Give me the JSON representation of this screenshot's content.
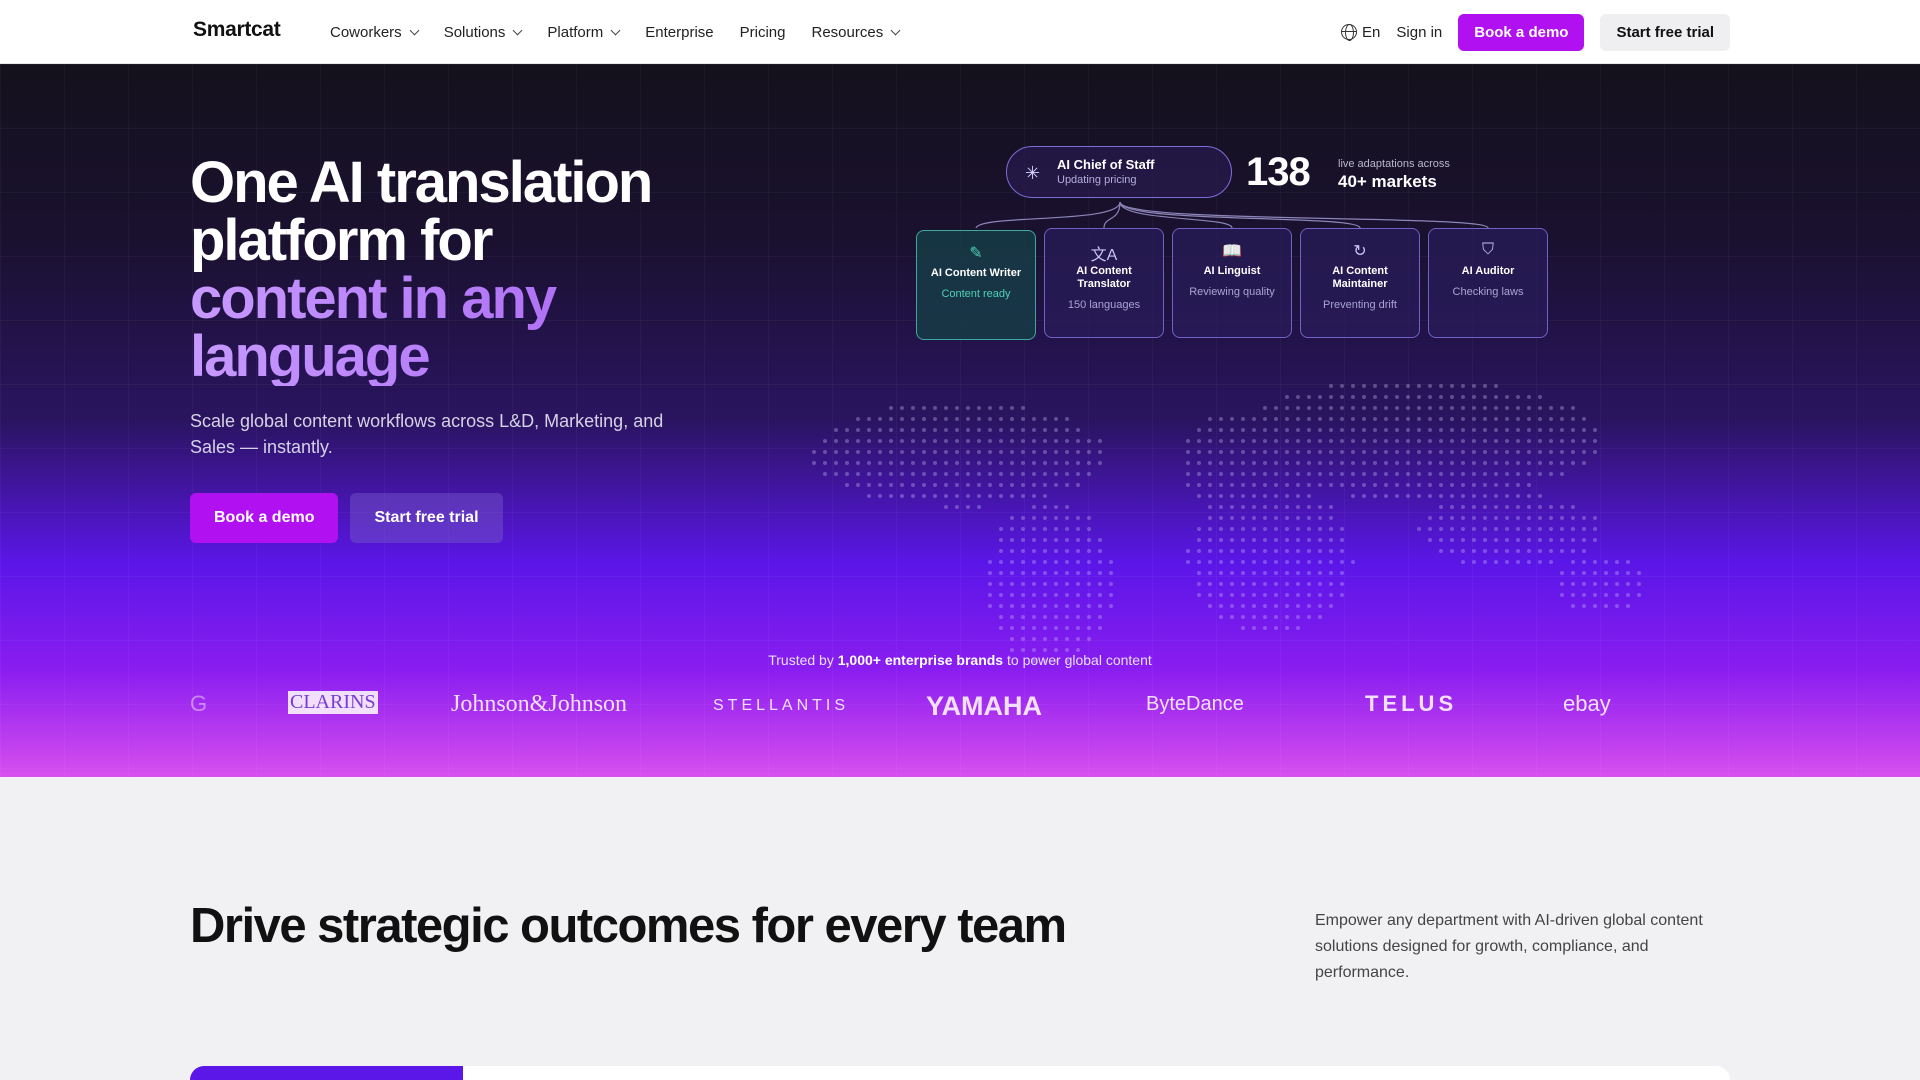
{
  "nav": {
    "logo": "Smartcat",
    "items": [
      {
        "label": "Coworkers",
        "dropdown": true
      },
      {
        "label": "Solutions",
        "dropdown": true
      },
      {
        "label": "Platform",
        "dropdown": true
      },
      {
        "label": "Enterprise",
        "dropdown": false
      },
      {
        "label": "Pricing",
        "dropdown": false
      },
      {
        "label": "Resources",
        "dropdown": true
      }
    ],
    "lang": "En",
    "signin": "Sign in",
    "book_demo": "Book a demo",
    "start_trial": "Start free trial"
  },
  "hero": {
    "title_line1": "One AI translation platform for",
    "title_line2": "content in any language",
    "subtitle": "Scale global content workflows across L&D, Marketing, and Sales — instantly.",
    "book_demo": "Book a demo",
    "start_trial": "Start free trial"
  },
  "diagram": {
    "chief": {
      "name": "AI Chief of Staff",
      "status": "Updating pricing"
    },
    "stat_number": "138",
    "stat_caption": "live adaptations across",
    "stat_markets": "40+ markets",
    "cards": [
      {
        "name": "AI Content Writer",
        "status": "Content ready",
        "icon": "edit-icon",
        "active": true
      },
      {
        "name": "AI Content Translator",
        "status": "150 languages",
        "icon": "translate-icon",
        "active": false
      },
      {
        "name": "AI Linguist",
        "status": "Reviewing quality",
        "icon": "book-icon",
        "active": false
      },
      {
        "name": "AI Content Maintainer",
        "status": "Preventing drift",
        "icon": "refresh-icon",
        "active": false
      },
      {
        "name": "AI Auditor",
        "status": "Checking laws",
        "icon": "shield-check-icon",
        "active": false
      }
    ]
  },
  "trusted": {
    "prefix": "Trusted by",
    "highlight": "1,000+ enterprise brands",
    "suffix": "to power global content"
  },
  "logos": [
    "G",
    "CLARINS",
    "Johnson&Johnson",
    "STELLANTIS",
    "YAMAHA",
    "ByteDance",
    "TELUS",
    "ebay"
  ],
  "section": {
    "title": "Drive strategic outcomes for every team",
    "description": "Empower any department with AI-driven global content solutions designed for growth, compliance, and performance."
  },
  "colors": {
    "accent": "#b111f0",
    "hero_dark": "#14111c",
    "hero_purple": "#5b16e8",
    "teal": "#4ed0b7"
  }
}
